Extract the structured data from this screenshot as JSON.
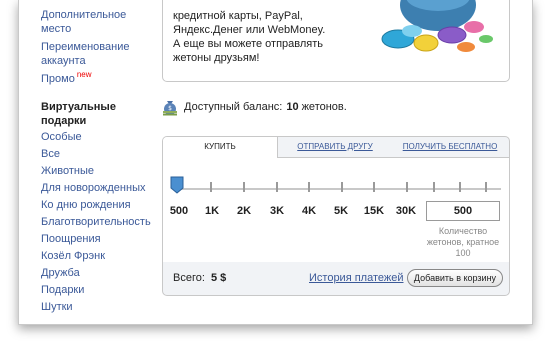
{
  "sidebar": {
    "links_top": [
      "Дополнительное место",
      "Переименование аккаунта"
    ],
    "promo": {
      "label": "Промо",
      "badge": "new"
    },
    "gifts_title": "Виртуальные подарки",
    "gifts": [
      "Особые",
      "Все",
      "Животные",
      "Для новорожденных",
      "Ко дню рождения",
      "Благотворительность",
      "Поощрения",
      "Козёл Фрэнк",
      "Дружба",
      "Подарки",
      "Шутки"
    ]
  },
  "promo_box": {
    "lines": [
      "кредитной карты, PayPal,",
      "Яндекс.Денег или WebMoney.",
      "А еще вы можете отправлять",
      "жетоны друзьям!"
    ],
    "image": "tokens-bag-image"
  },
  "balance": {
    "icon": "money-bag-icon",
    "prefix": "Доступный баланс:",
    "amount": "10",
    "unit": "жетонов."
  },
  "tabs": [
    "КУПИТЬ",
    "ОТПРАВИТЬ ДРУГУ",
    "ПОЛУЧИТЬ БЕСПЛАТНО"
  ],
  "slider": {
    "labels": [
      "500",
      "1K",
      "2K",
      "3K",
      "4K",
      "5K",
      "15K",
      "30K"
    ],
    "selected": "500"
  },
  "amount_input": {
    "value": "500"
  },
  "hint": "Количество жетонов, кратное 100",
  "footer": {
    "total_label": "Всего:",
    "total_value": "5 $",
    "history_link": "История платежей",
    "add_button": "Добавить в корзину"
  },
  "colors": {
    "link": "#3b5998",
    "border": "#c8c8c8",
    "panel_bg": "#f1f3f6"
  }
}
